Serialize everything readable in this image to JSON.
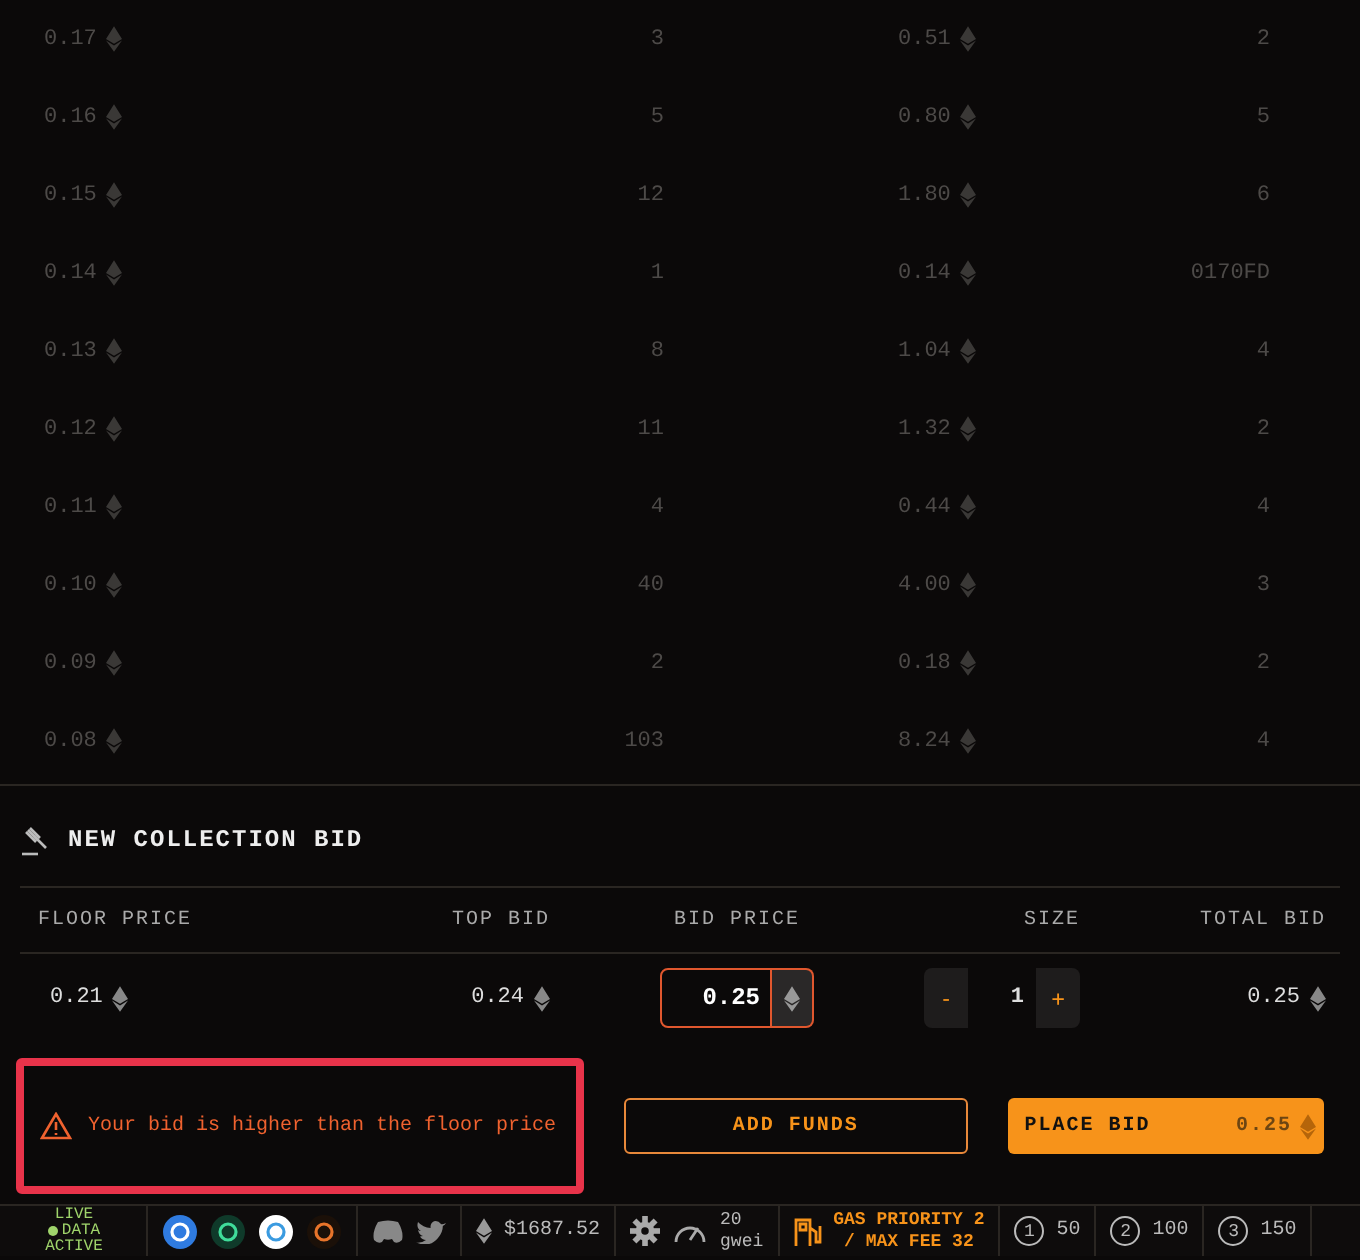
{
  "order_book": {
    "rows": [
      {
        "price": "0.17",
        "count": "3",
        "total": "0.51",
        "column_4": "2"
      },
      {
        "price": "0.16",
        "count": "5",
        "total": "0.80",
        "column_4": "5"
      },
      {
        "price": "0.15",
        "count": "12",
        "total": "1.80",
        "column_4": "6"
      },
      {
        "price": "0.14",
        "count": "1",
        "total": "0.14",
        "column_4": "0170FD"
      },
      {
        "price": "0.13",
        "count": "8",
        "total": "1.04",
        "column_4": "4"
      },
      {
        "price": "0.12",
        "count": "11",
        "total": "1.32",
        "column_4": "2"
      },
      {
        "price": "0.11",
        "count": "4",
        "total": "0.44",
        "column_4": "4"
      },
      {
        "price": "0.10",
        "count": "40",
        "total": "4.00",
        "column_4": "3"
      },
      {
        "price": "0.09",
        "count": "2",
        "total": "0.18",
        "column_4": "2"
      },
      {
        "price": "0.08",
        "count": "103",
        "total": "8.24",
        "column_4": "4"
      }
    ]
  },
  "bid_panel": {
    "title": "NEW COLLECTION BID",
    "columns": [
      "FLOOR PRICE",
      "TOP BID",
      "BID PRICE",
      "SIZE",
      "TOTAL BID"
    ],
    "floor_price": "0.21",
    "top_bid": "0.24",
    "bid_price": "0.25",
    "size": {
      "decrement": "-",
      "value": "1",
      "increment": "+"
    },
    "total_bid": "0.25",
    "warning": "Your bid is higher than the floor price",
    "add_funds": "ADD FUNDS",
    "place_bid": {
      "label": "PLACE BID",
      "amount": "0.25"
    }
  },
  "status_bar": {
    "live": [
      "LIVE",
      "DATA",
      "ACTIVE"
    ],
    "eth_price": "$1687.52",
    "gas": [
      "20",
      "gwei"
    ],
    "gas_priority": [
      "GAS PRIORITY 2",
      "/ MAX FEE 32"
    ],
    "presets": [
      {
        "number": "1",
        "value": "50"
      },
      {
        "number": "2",
        "value": "100"
      },
      {
        "number": "3",
        "value": "150"
      }
    ]
  }
}
